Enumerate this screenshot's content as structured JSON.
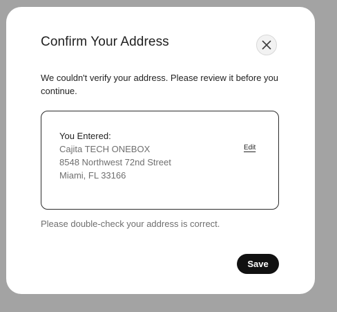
{
  "dialog": {
    "title": "Confirm Your Address",
    "message": "We couldn't verify your address. Please review it before you continue.",
    "close_icon": "close-icon",
    "address": {
      "heading": "You Entered:",
      "lines": [
        "Cajita TECH ONEBOX",
        "8548 Northwest 72nd Street",
        "Miami, FL 33166"
      ],
      "edit_label": "Edit"
    },
    "hint": "Please double-check your address is correct.",
    "save_label": "Save"
  },
  "colors": {
    "backdrop": "#a3a3a3",
    "modal_background": "#ffffff",
    "primary_button": "#111111",
    "muted_text": "#6f6f6f"
  }
}
